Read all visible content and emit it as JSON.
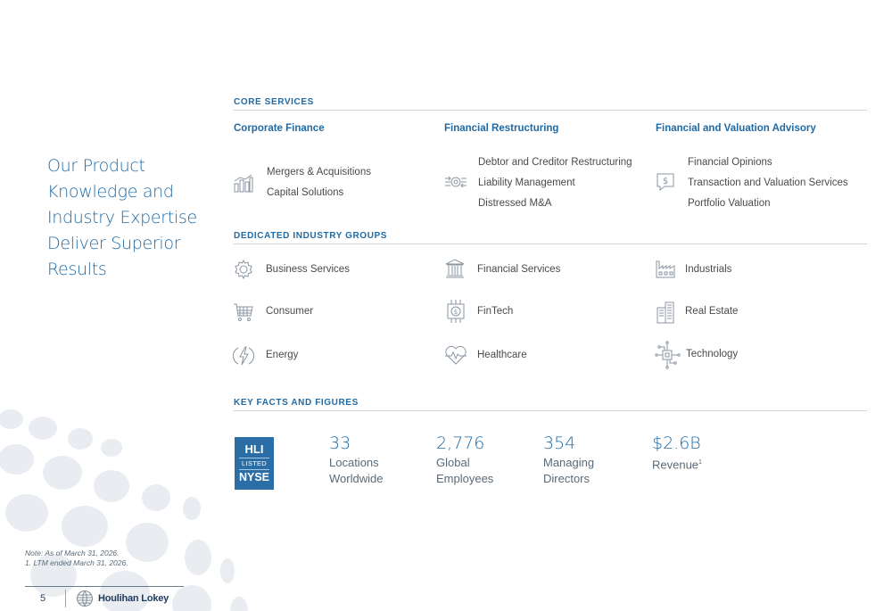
{
  "heading": {
    "lines": [
      "Our Product",
      "Knowledge and",
      "Industry Expertise",
      "Deliver Superior",
      "Results"
    ]
  },
  "core_services": {
    "title": "CORE SERVICES",
    "columns": [
      {
        "title": "Corporate Finance",
        "icon": "bar-chart-icon",
        "items": [
          "Mergers & Acquisitions",
          "Capital Solutions"
        ]
      },
      {
        "title": "Financial Restructuring",
        "icon": "gears-arrows-icon",
        "items": [
          "Debtor and Creditor Restructuring",
          "Liability Management",
          "Distressed M&A"
        ]
      },
      {
        "title": "Financial and Valuation Advisory",
        "icon": "dollar-chat-icon",
        "items": [
          "Financial Opinions",
          "Transaction and Valuation Services",
          "Portfolio Valuation"
        ]
      }
    ]
  },
  "industry_groups": {
    "title": "DEDICATED INDUSTRY GROUPS",
    "items": [
      {
        "label": "Business Services",
        "icon": "gear-icon"
      },
      {
        "label": "Financial Services",
        "icon": "bank-icon"
      },
      {
        "label": "Industrials",
        "icon": "factory-icon"
      },
      {
        "label": "Consumer",
        "icon": "shopping-cart-icon"
      },
      {
        "label": "FinTech",
        "icon": "fintech-chip-icon"
      },
      {
        "label": "Real Estate",
        "icon": "buildings-icon"
      },
      {
        "label": "Energy",
        "icon": "lightning-icon"
      },
      {
        "label": "Healthcare",
        "icon": "heartbeat-icon"
      },
      {
        "label": "Technology",
        "icon": "circuit-icon"
      }
    ]
  },
  "key_facts": {
    "title": "KEY FACTS AND FIGURES",
    "badge": {
      "top": "HLI",
      "middle": "LISTED",
      "bottom": "NYSE"
    },
    "facts": [
      {
        "value": "33",
        "label_lines": [
          "Locations",
          "Worldwide"
        ]
      },
      {
        "value": "2,776",
        "label_lines": [
          "Global",
          "Employees"
        ]
      },
      {
        "value": "354",
        "label_lines": [
          "Managing",
          "Directors"
        ]
      },
      {
        "value": "$2.6B",
        "label_lines": [
          "Revenue"
        ],
        "footnote_mark": "1"
      }
    ]
  },
  "notes": [
    "Note: As of March 31, 2026.",
    "1. LTM ended March 31, 2026."
  ],
  "footer": {
    "page_number": "5",
    "brand": "Houlihan Lokey"
  },
  "colors": {
    "accent": "#1f6aa5",
    "text": "#4a4a4a",
    "rule": "#cfd4d9",
    "badge": "#2b6ea6",
    "dots": "#e9edf2"
  }
}
